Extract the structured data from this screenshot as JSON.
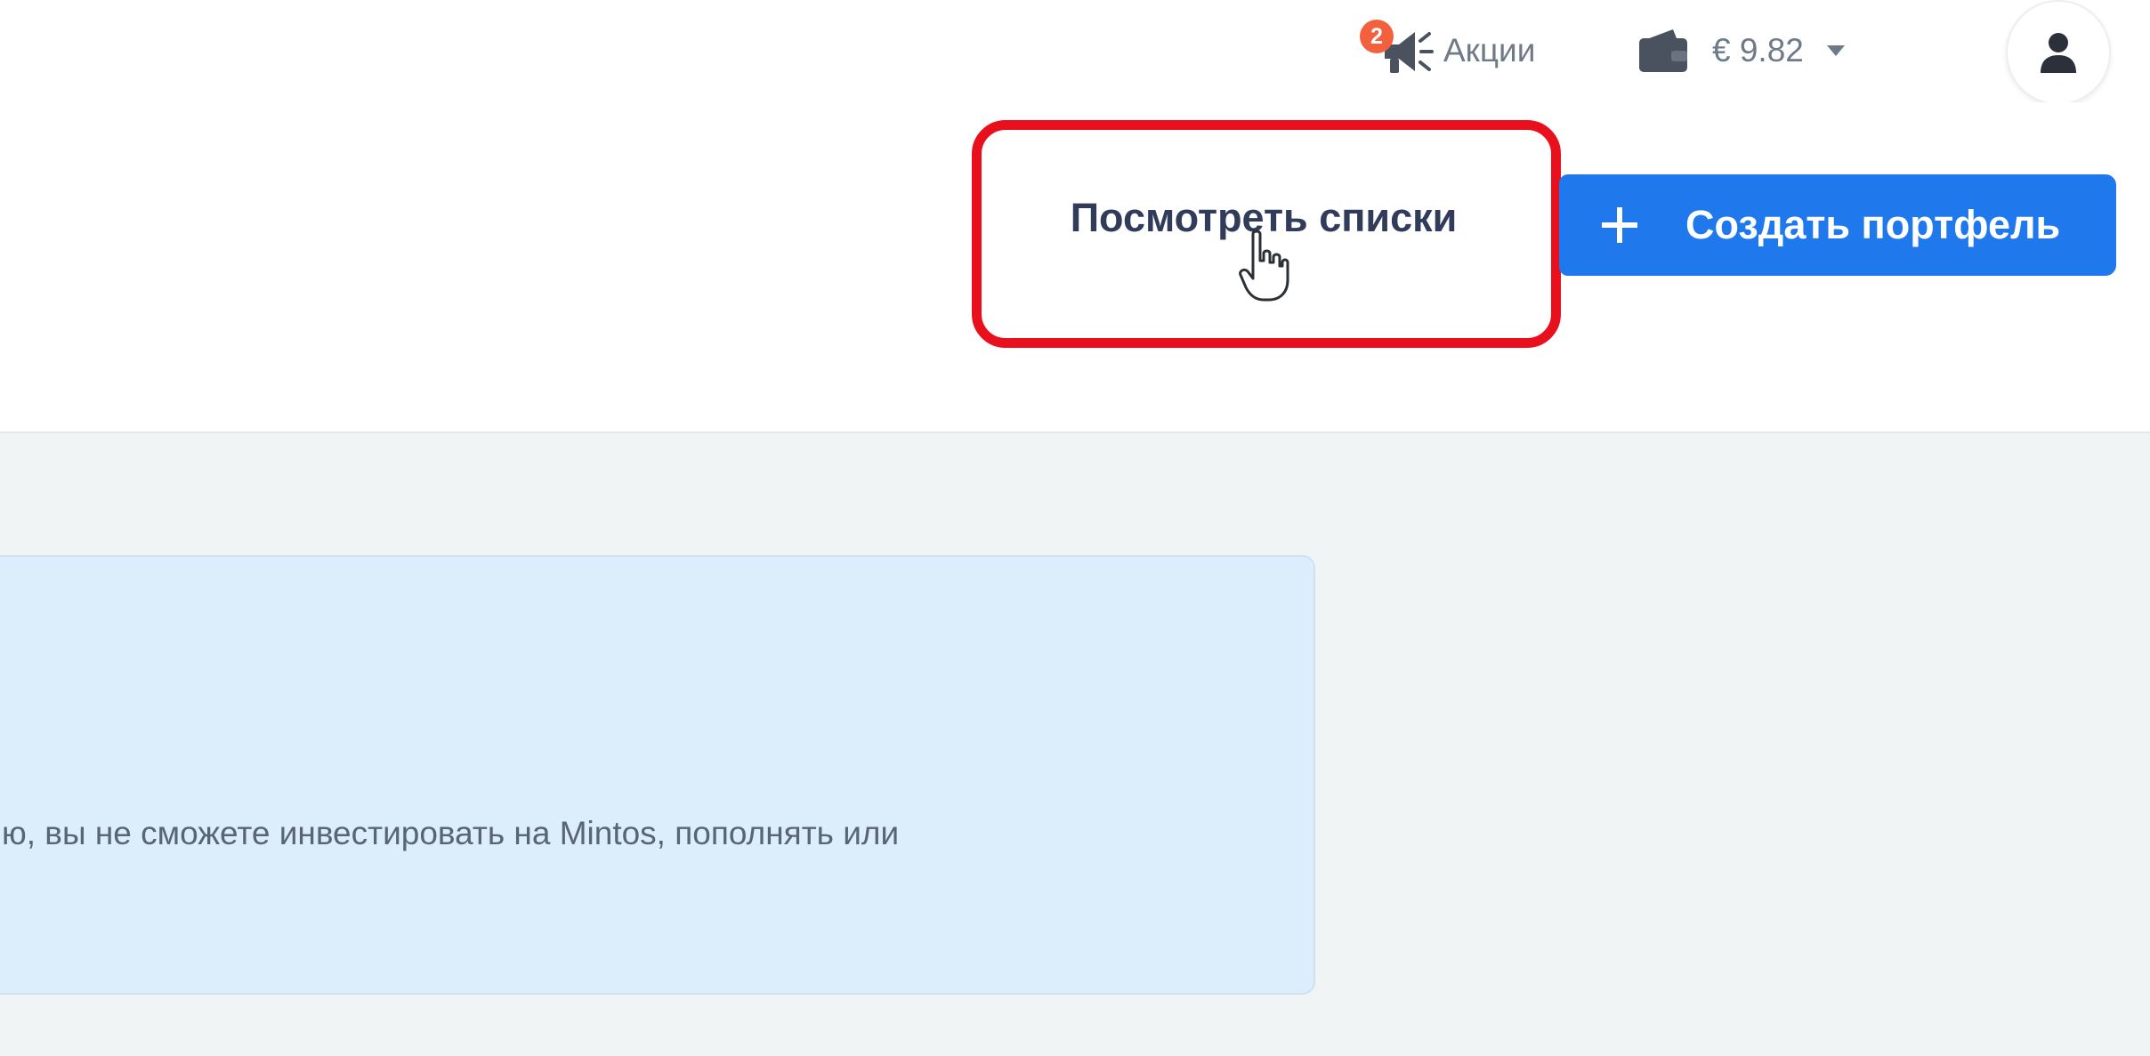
{
  "header": {
    "promotions": {
      "badge_count": "2",
      "label": "Акции",
      "icon": "megaphone-icon",
      "badge_color": "#f2603d"
    },
    "wallet": {
      "amount": "€ 9.82",
      "icon": "wallet-icon",
      "dropdown_icon": "caret-down-icon"
    },
    "account": {
      "icon": "user-icon"
    }
  },
  "actions": {
    "view_lists_label": "Посмотреть списки",
    "create_portfolio_label": "Создать портфель",
    "create_icon": "plus-icon",
    "primary_color": "#1f78ec",
    "highlight_color": "#e8101c"
  },
  "notice": {
    "text": "ю, вы не сможете инвестировать на Mintos, пополнять или",
    "background": "#dcedfb"
  }
}
